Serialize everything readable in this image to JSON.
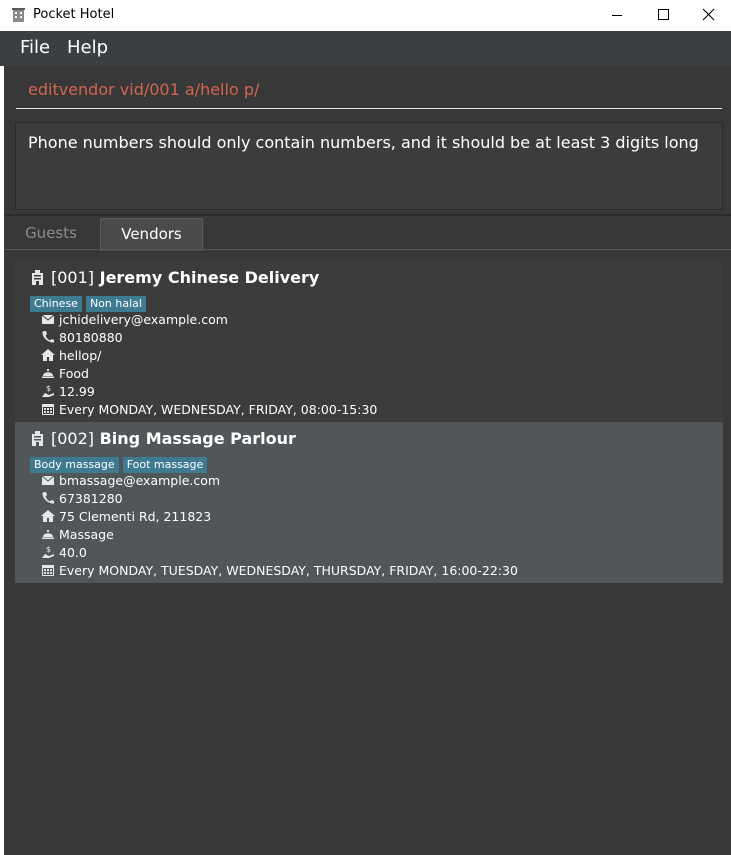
{
  "window": {
    "title": "Pocket Hotel"
  },
  "menu": {
    "items": [
      "File",
      "Help"
    ]
  },
  "command": {
    "value": "editvendor vid/001 a/hello p/"
  },
  "result": {
    "message": "Phone numbers should only contain numbers, and it should be at least 3 digits long"
  },
  "tabs": [
    {
      "label": "Guests",
      "active": false
    },
    {
      "label": "Vendors",
      "active": true
    }
  ],
  "vendors": [
    {
      "id": "[001]",
      "name": "Jeremy Chinese Delivery",
      "tags": [
        "Chinese",
        "Non halal"
      ],
      "email": "jchidelivery@example.com",
      "phone": "80180880",
      "address": "hellop/",
      "service": "Food",
      "cost": "12.99",
      "schedule": "Every MONDAY, WEDNESDAY, FRIDAY,  08:00-15:30"
    },
    {
      "id": "[002]",
      "name": "Bing Massage Parlour",
      "tags": [
        "Body massage",
        "Foot massage"
      ],
      "email": "bmassage@example.com",
      "phone": "67381280",
      "address": "75 Clementi Rd, 211823",
      "service": "Massage",
      "cost": "40.0",
      "schedule": "Every MONDAY, TUESDAY, WEDNESDAY, THURSDAY, FRIDAY,  16:00-22:30"
    }
  ],
  "colors": {
    "accent_tag": "#3e7b91",
    "command_text": "#d06651",
    "background": "#383838",
    "selected_card": "#515658"
  }
}
